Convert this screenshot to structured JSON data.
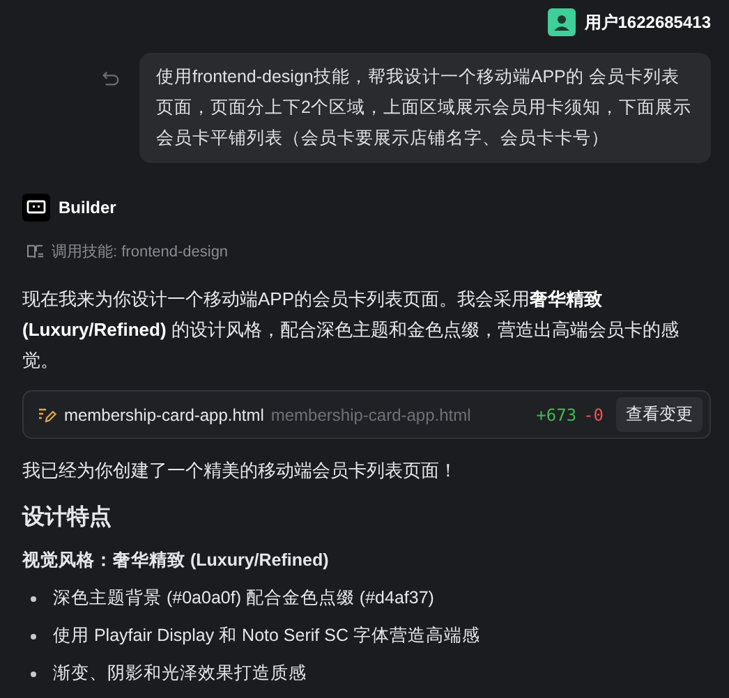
{
  "user": {
    "name": "用户1622685413"
  },
  "user_message": {
    "text": "使用frontend-design技能，帮我设计一个移动端APP的 会员卡列表页面，页面分上下2个区域，上面区域展示会员用卡须知，下面展示会员卡平铺列表（会员卡要展示店铺名字、会员卡卡号）"
  },
  "assistant": {
    "name": "Builder",
    "skill": "调用技能: frontend-design"
  },
  "intro": "现在我来为你设计一个移动端APP的会员卡列表页面。我会采用**奢华精致 (Luxury/Refined)** 的设计风格，配合深色主题和金色点缀，营造出高端会员卡的感觉。",
  "file_change": {
    "filename": "membership-card-app.html",
    "path": "membership-card-app.html",
    "added": "+673",
    "removed": "-0",
    "button": "查看变更"
  },
  "summary": "我已经为你创建了一个精美的移动端会员卡列表页面！",
  "heading": "设计特点",
  "subheading": "视觉风格：奢华精致 (Luxury/Refined)",
  "bullets": [
    "深色主题背景 (#0a0a0f) 配合金色点缀 (#d4af37)",
    "使用 Playfair Display 和 Noto Serif SC 字体营造高端感",
    "渐变、阴影和光泽效果打造质感"
  ]
}
